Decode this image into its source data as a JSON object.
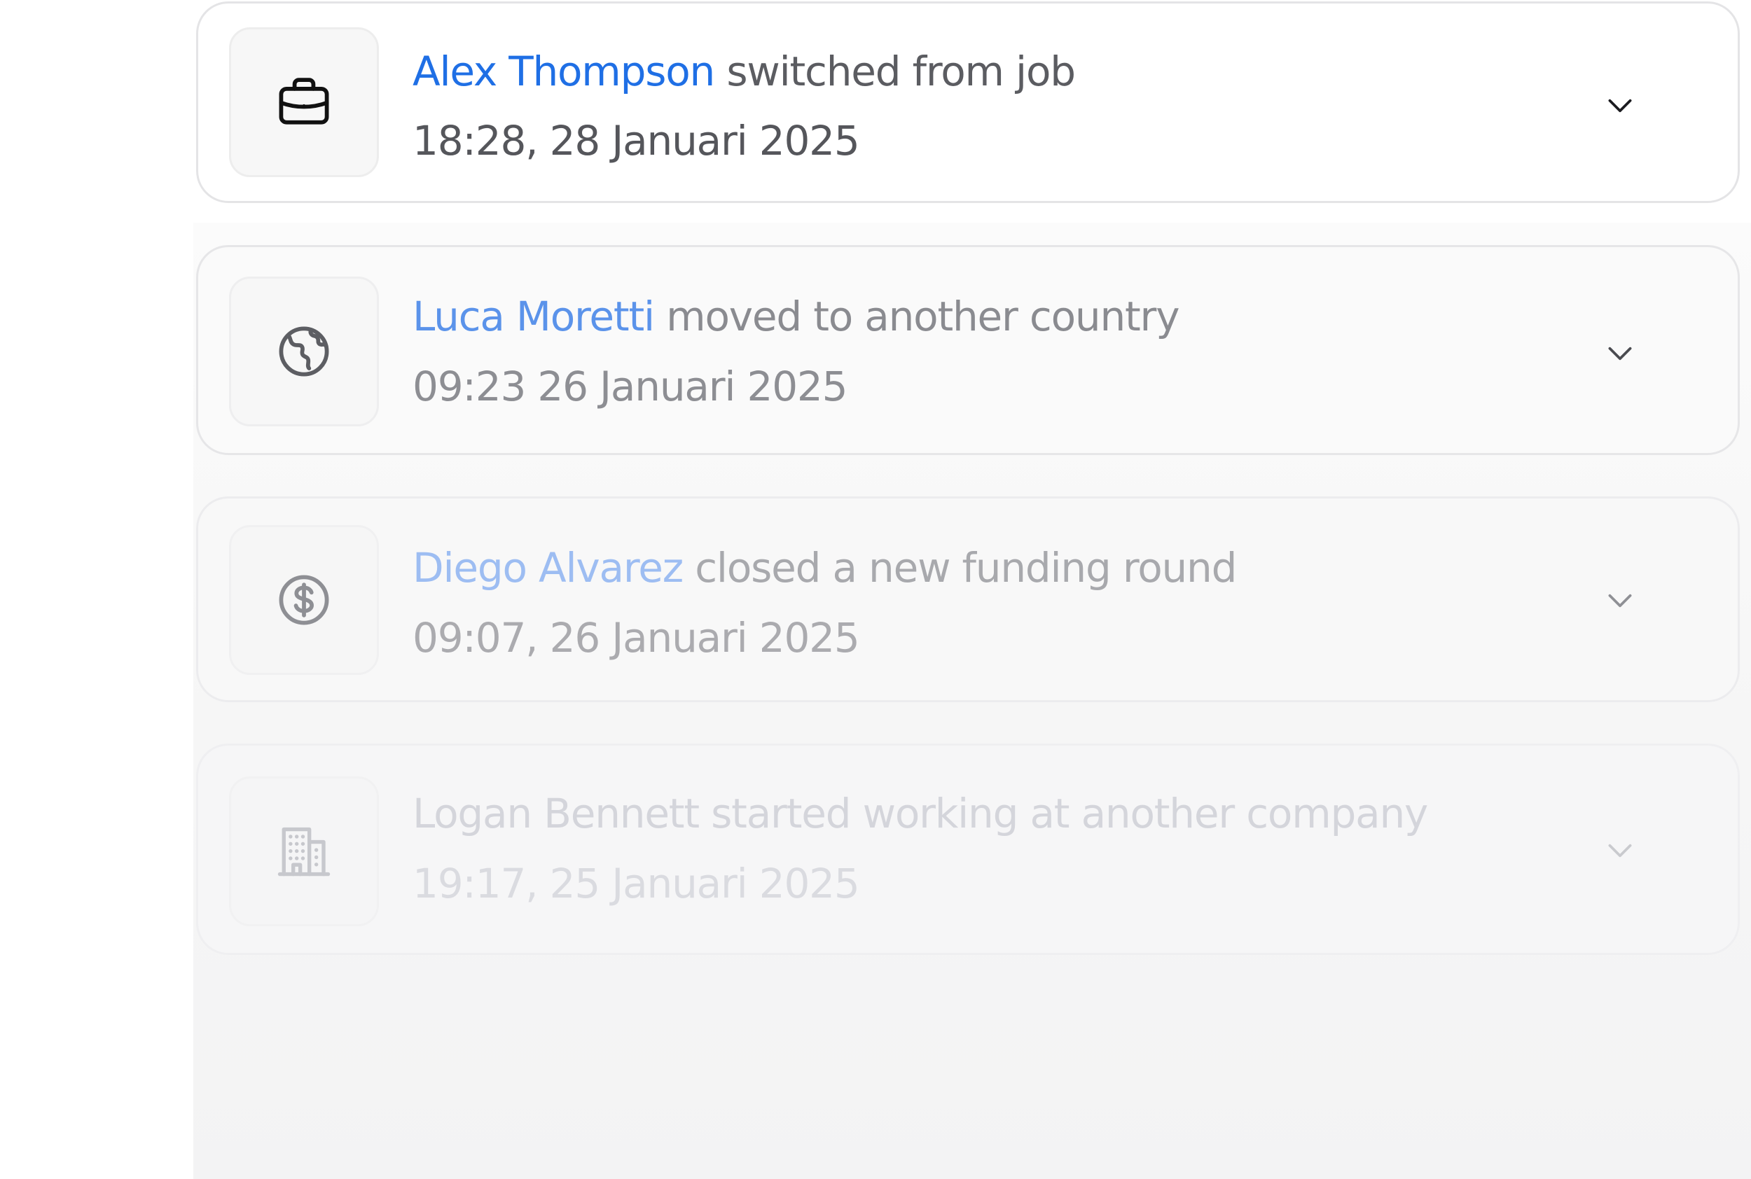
{
  "feed": {
    "items": [
      {
        "name": "Alex Thompson",
        "action": "switched from job",
        "timestamp": "18:28, 28 Januari 2025",
        "icon": "briefcase-icon"
      },
      {
        "name": "Luca Moretti",
        "action": "moved to another country",
        "timestamp": "09:23 26 Januari 2025",
        "icon": "globe-icon"
      },
      {
        "name": "Diego Alvarez",
        "action": "closed a new funding round",
        "timestamp": "09:07, 26 Januari 2025",
        "icon": "dollar-circle-icon"
      },
      {
        "name": "Logan Bennett",
        "action": "started working at another company",
        "timestamp": "19:17, 25 Januari 2025",
        "icon": "building-icon"
      }
    ],
    "expand_icon": "chevron-down-icon"
  },
  "colors": {
    "accent": "#1f6fe5",
    "card_border": "#e4e4e6",
    "icon_box_bg": "#f7f7f7",
    "text_secondary": "#5b5c61"
  }
}
